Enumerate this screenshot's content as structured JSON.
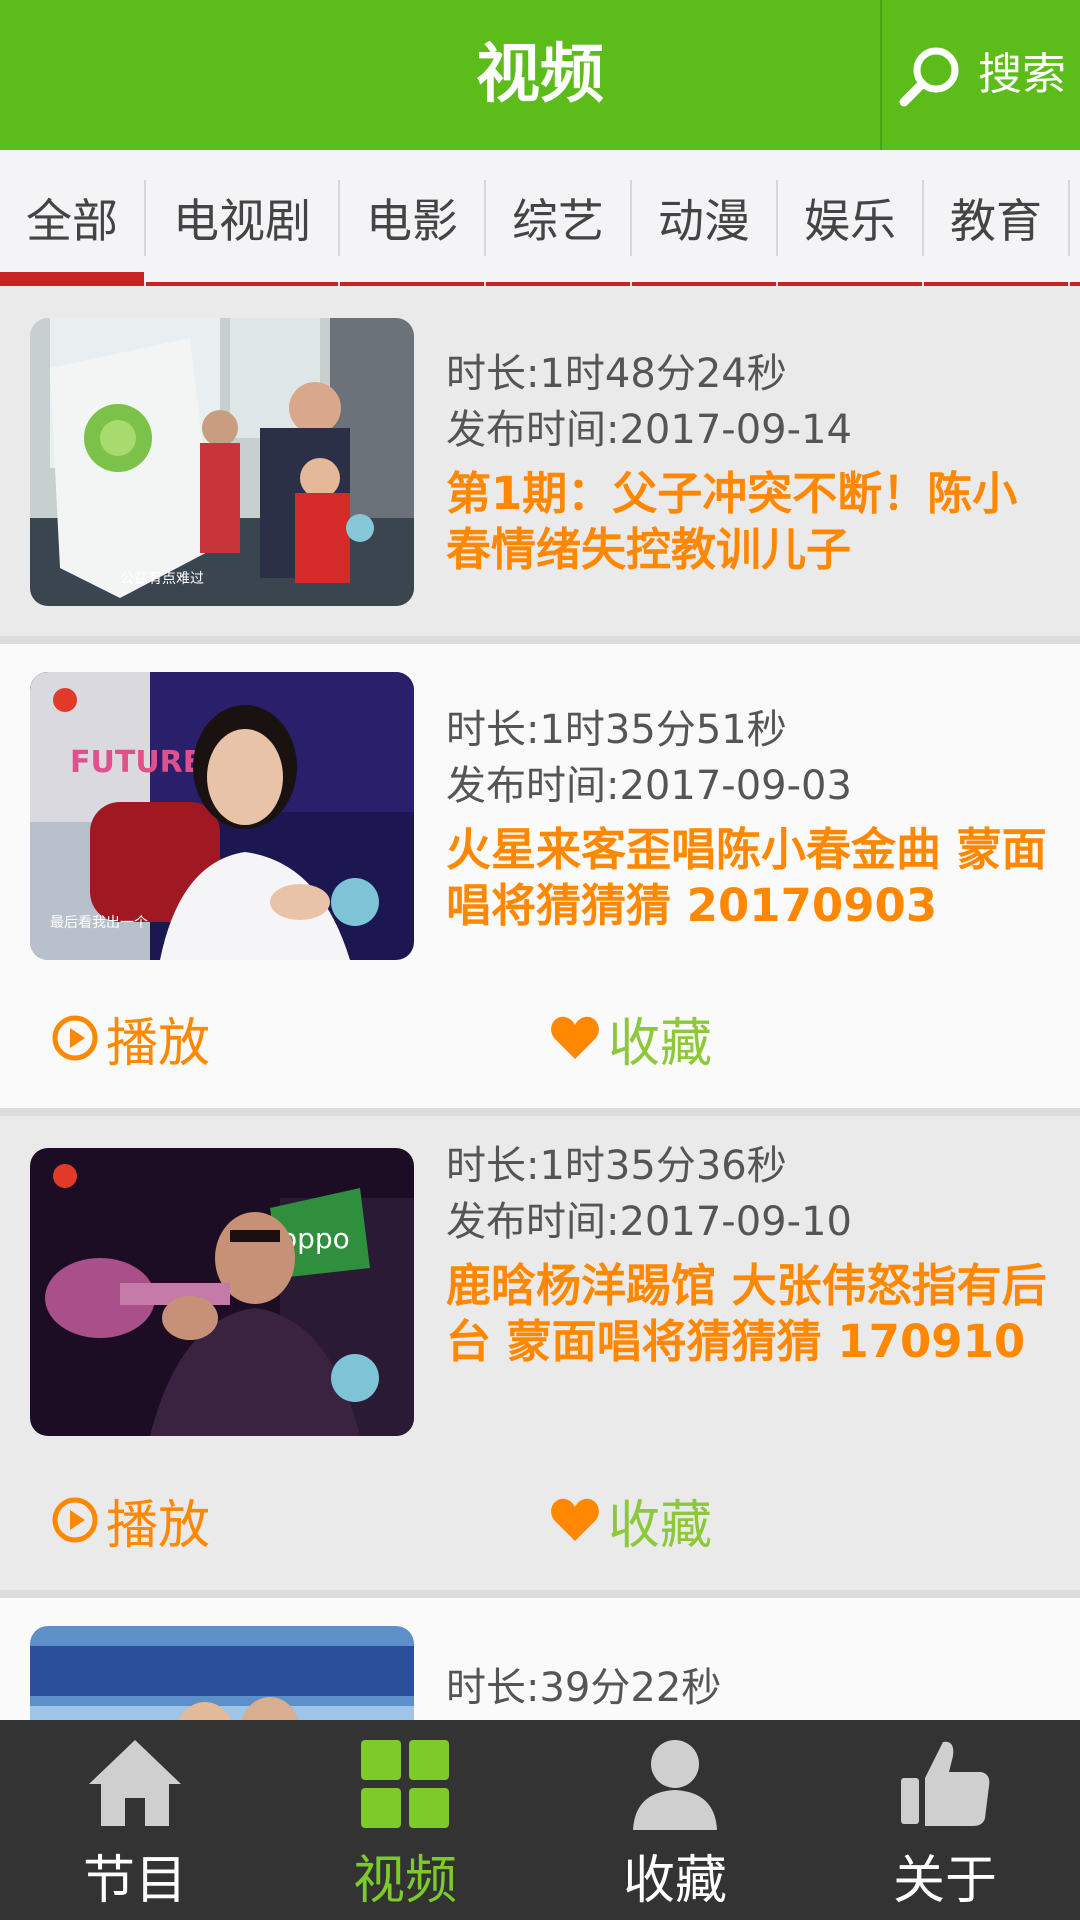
{
  "header": {
    "title": "视频",
    "search_label": "搜索"
  },
  "tabs": [
    "全部",
    "电视剧",
    "电影",
    "综艺",
    "动漫",
    "娱乐",
    "教育"
  ],
  "active_tab": "全部",
  "videos": [
    {
      "duration": "时长:1时48分24秒",
      "publish": "发布时间:2017-09-14",
      "title": "第1期：父子冲突不断！陈小春情绪失控教训儿子",
      "thumb_caption": "公益有点难过"
    },
    {
      "duration": "时长:1时35分51秒",
      "publish": "发布时间:2017-09-03",
      "title": "火星来客歪唱陈小春金曲 蒙面唱将猜猜猜 20170903",
      "thumb_brand": "FUTURE",
      "thumb_caption": "最后看我出一个",
      "play_label": "播放",
      "fav_label": "收藏"
    },
    {
      "duration": "时长:1时35分36秒",
      "publish": "发布时间:2017-09-10",
      "title": "鹿晗杨洋踢馆 大张伟怒指有后台 蒙面唱将猜猜猜 170910",
      "thumb_brand": "oppo",
      "play_label": "播放",
      "fav_label": "收藏"
    },
    {
      "duration": "时长:39分22秒"
    }
  ],
  "bottom_nav": [
    {
      "label": "节目",
      "icon": "home-icon"
    },
    {
      "label": "视频",
      "icon": "grid-icon"
    },
    {
      "label": "收藏",
      "icon": "person-icon"
    },
    {
      "label": "关于",
      "icon": "thumbs-up-icon"
    }
  ],
  "active_nav": "视频",
  "colors": {
    "header_green": "#5cbd1a",
    "title_orange": "#ff8800",
    "fav_green": "#8cc83a",
    "tab_red": "#c82222",
    "nav_bg": "#333333",
    "nav_active": "#7ccb2a"
  }
}
